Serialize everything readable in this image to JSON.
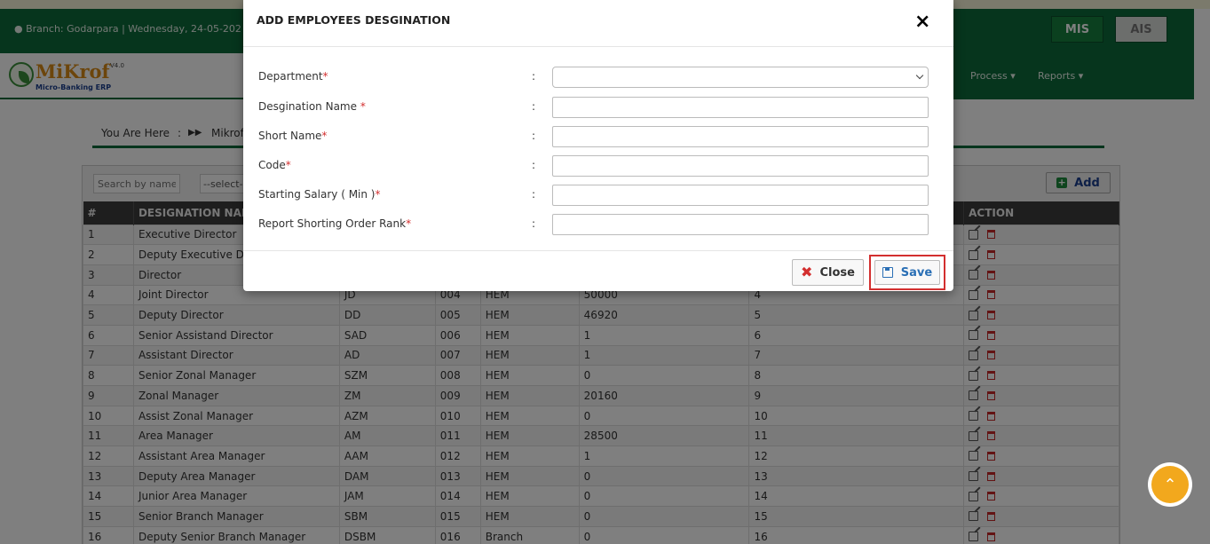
{
  "header": {
    "branch_text": "Branch: Godarpara | Wednesday, 24-05-202",
    "mis_label": "MIS",
    "ais_label": "AIS"
  },
  "logo": {
    "name": "MiKrof",
    "version": "V4.0",
    "subtitle": "Micro-Banking ERP"
  },
  "nav": {
    "process_label": "Process ▾",
    "reports_label": "Reports ▾"
  },
  "breadcrumb": {
    "prefix": "You Are Here",
    "colon": ":",
    "arrows": "▶▶",
    "path": "Mikrof"
  },
  "filters": {
    "search_placeholder": "Search by name",
    "select_value": "--select--"
  },
  "add_label": "Add",
  "table": {
    "headers": [
      "#",
      "DESIGNATION NAME",
      "",
      "",
      "",
      "",
      "",
      "ACTION"
    ],
    "rows": [
      [
        "1",
        "Executive Director",
        "",
        "",
        "",
        "",
        ""
      ],
      [
        "2",
        "Deputy Executive Director",
        "",
        "",
        "",
        "",
        ""
      ],
      [
        "3",
        "Director",
        "",
        "",
        "",
        "",
        ""
      ],
      [
        "4",
        "Joint Director",
        "JD",
        "004",
        "HEM",
        "50000",
        "4"
      ],
      [
        "5",
        "Deputy Director",
        "DD",
        "005",
        "HEM",
        "46920",
        "5"
      ],
      [
        "6",
        "Senior Assistand Director",
        "SAD",
        "006",
        "HEM",
        "1",
        "6"
      ],
      [
        "7",
        "Assistant Director",
        "AD",
        "007",
        "HEM",
        "1",
        "7"
      ],
      [
        "8",
        "Senior Zonal Manager",
        "SZM",
        "008",
        "HEM",
        "0",
        "8"
      ],
      [
        "9",
        "Zonal Manager",
        "ZM",
        "009",
        "HEM",
        "20160",
        "9"
      ],
      [
        "10",
        "Assist Zonal Manager",
        "AZM",
        "010",
        "HEM",
        "0",
        "10"
      ],
      [
        "11",
        "Area Manager",
        "AM",
        "011",
        "HEM",
        "28500",
        "11"
      ],
      [
        "12",
        "Assistant Area Manager",
        "AAM",
        "012",
        "HEM",
        "1",
        "12"
      ],
      [
        "13",
        "Deputy Area Manager",
        "DAM",
        "013",
        "HEM",
        "0",
        "13"
      ],
      [
        "14",
        "Junior Area Manager",
        "JAM",
        "014",
        "HEM",
        "0",
        "14"
      ],
      [
        "15",
        "Senior Branch Manager",
        "SBM",
        "015",
        "HEM",
        "0",
        "15"
      ],
      [
        "16",
        "Deputy Senior Branch Manager",
        "DSBM",
        "016",
        "Branch",
        "0",
        "16"
      ]
    ]
  },
  "modal": {
    "title": "ADD EMPLOYEES DESGINATION",
    "close_x": "×",
    "fields": [
      {
        "label": "Department",
        "required": "*",
        "value": ""
      },
      {
        "label": "Desgination Name ",
        "required": "*",
        "value": ""
      },
      {
        "label": "Short Name",
        "required": "*",
        "value": ""
      },
      {
        "label": "Code",
        "required": "*",
        "value": ""
      },
      {
        "label": "Starting Salary ( Min )",
        "required": "*",
        "value": ""
      },
      {
        "label": "Report Shorting Order Rank",
        "required": "*",
        "value": ""
      }
    ],
    "colon": ":",
    "close_label": "Close",
    "save_label": "Save"
  },
  "icons": {
    "scroll_top": "chevron-up-icon"
  }
}
